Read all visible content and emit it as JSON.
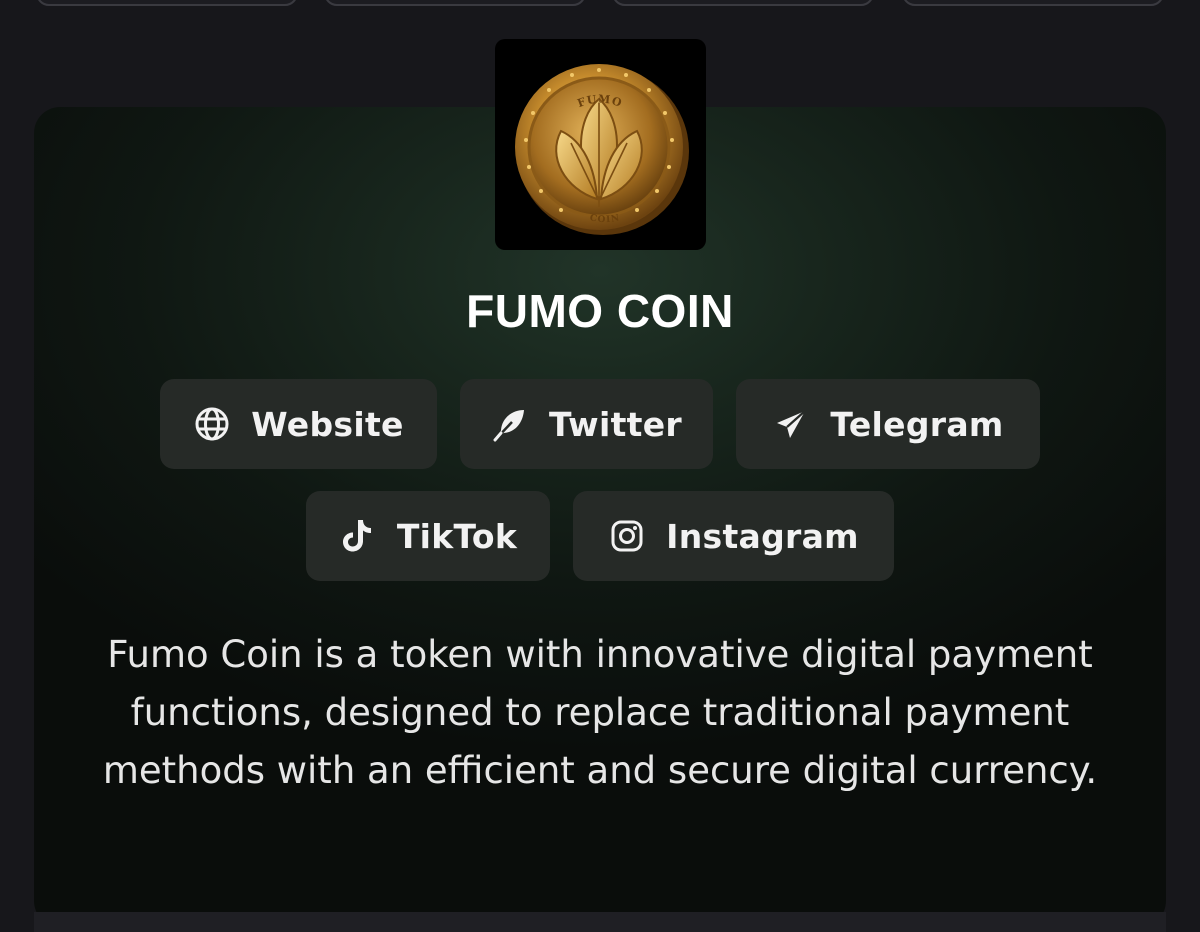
{
  "project": {
    "name": "FUMO COIN",
    "description": "Fumo Coin is a token with innovative digital payment functions, designed to replace traditional payment methods with an efficient and secure digital currency.",
    "logo_text_top": "FUMO",
    "logo_text_bottom": "COIN"
  },
  "links": [
    {
      "label": "Website",
      "icon": "globe-icon"
    },
    {
      "label": "Twitter",
      "icon": "feather-icon"
    },
    {
      "label": "Telegram",
      "icon": "paper-plane-icon"
    },
    {
      "label": "TikTok",
      "icon": "tiktok-icon"
    },
    {
      "label": "Instagram",
      "icon": "instagram-icon"
    }
  ],
  "colors": {
    "page_background": "#17171b",
    "card_accent": "#213428",
    "button_background": "#262a27",
    "coin_gold": "#c8912e"
  }
}
